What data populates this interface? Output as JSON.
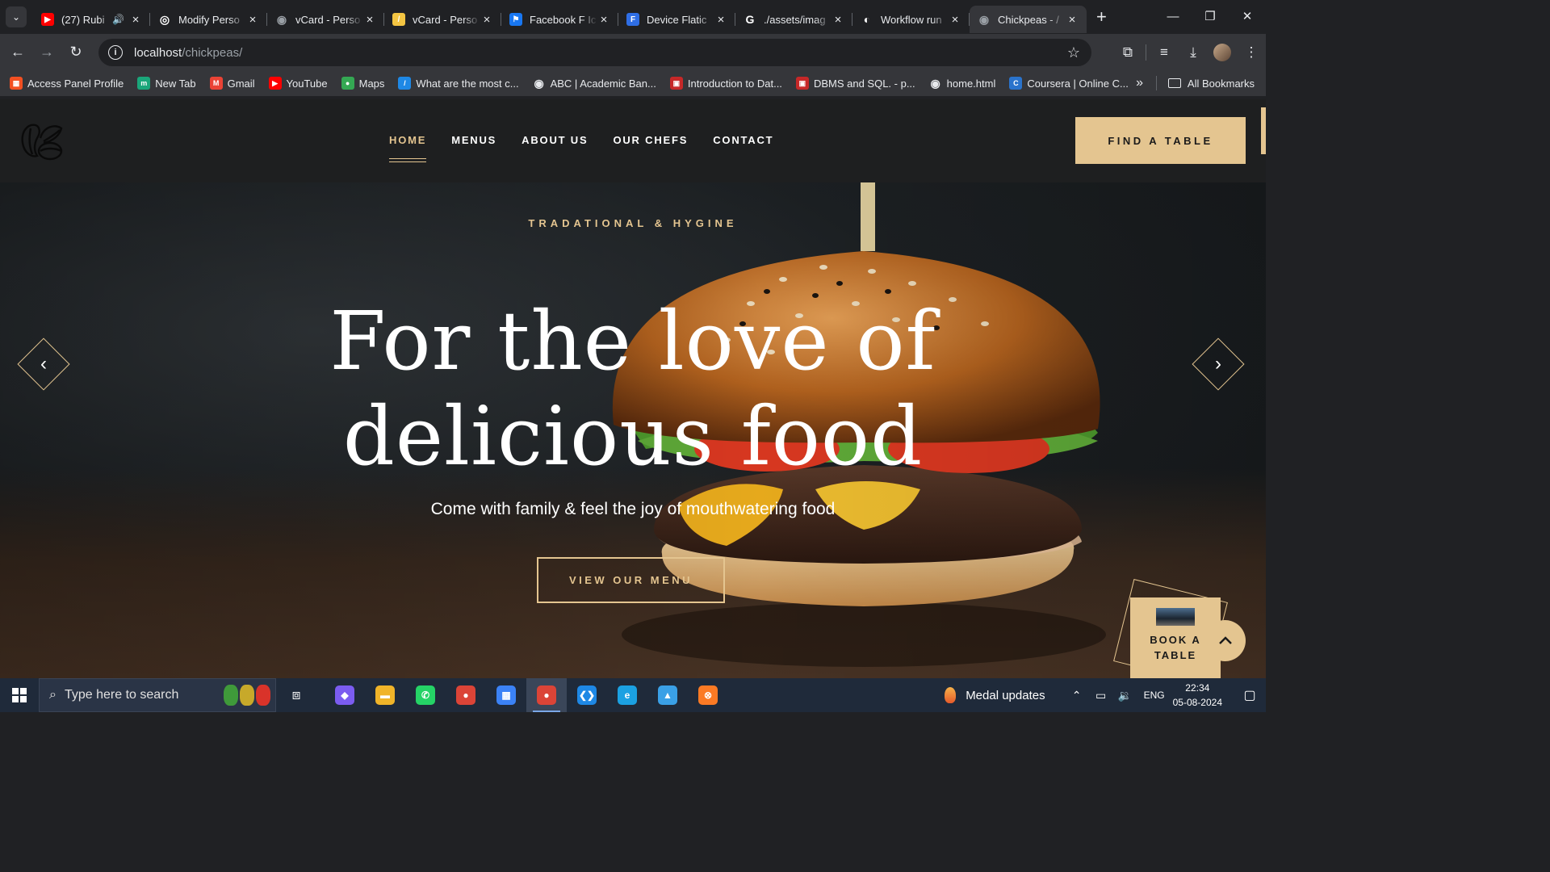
{
  "browser": {
    "tabs": [
      {
        "title": "(27) Rubi",
        "favicon_color": "#ff0000",
        "favicon_glyph": "▶",
        "audio": true,
        "active": false
      },
      {
        "title": "Modify Perso",
        "favicon_color": "#ffffff",
        "favicon_glyph": "◎",
        "audio": false,
        "active": false
      },
      {
        "title": "vCard - Perso",
        "favicon_color": "#9aa0a6",
        "favicon_glyph": "◉",
        "audio": false,
        "active": false
      },
      {
        "title": "vCard - Perso",
        "favicon_color": "#f4c542",
        "favicon_glyph": "/",
        "audio": false,
        "active": false
      },
      {
        "title": "Facebook F Ic",
        "favicon_color": "#1877f2",
        "favicon_glyph": "⚑",
        "audio": false,
        "active": false
      },
      {
        "title": "Device Flatic",
        "favicon_color": "#2f6ee5",
        "favicon_glyph": "F",
        "audio": false,
        "active": false
      },
      {
        "title": "./assets/imag",
        "favicon_color": "#ffffff",
        "favicon_glyph": "G",
        "audio": false,
        "active": false
      },
      {
        "title": "Workflow run",
        "favicon_color": "#ffffff",
        "favicon_glyph": "◐",
        "audio": false,
        "active": false
      },
      {
        "title": "Chickpeas - /",
        "favicon_color": "#9aa0a6",
        "favicon_glyph": "◉",
        "audio": false,
        "active": true
      }
    ],
    "url_host": "localhost",
    "url_path": "/chickpeas/",
    "bookmarks": [
      {
        "label": "Access Panel Profile",
        "color": "#f25022",
        "glyph": "▦"
      },
      {
        "label": "New Tab",
        "color": "#1aa67a",
        "glyph": "m"
      },
      {
        "label": "Gmail",
        "color": "#ea4335",
        "glyph": "M"
      },
      {
        "label": "YouTube",
        "color": "#ff0000",
        "glyph": "▶"
      },
      {
        "label": "Maps",
        "color": "#34a853",
        "glyph": "●"
      },
      {
        "label": "What are the most c...",
        "color": "#1e88e5",
        "glyph": "/"
      },
      {
        "label": "ABC | Academic Ban...",
        "color": "#9aa0a6",
        "glyph": "◉"
      },
      {
        "label": "Introduction to Dat...",
        "color": "#c62828",
        "glyph": "▣"
      },
      {
        "label": "DBMS and SQL. - p...",
        "color": "#c62828",
        "glyph": "▣"
      },
      {
        "label": "home.html",
        "color": "#9aa0a6",
        "glyph": "◉"
      },
      {
        "label": "Coursera | Online C...",
        "color": "#2a73cc",
        "glyph": "C"
      }
    ],
    "all_bookmarks_label": "All Bookmarks"
  },
  "site": {
    "nav": [
      {
        "label": "HOME",
        "active": true
      },
      {
        "label": "MENUS",
        "active": false
      },
      {
        "label": "ABOUT US",
        "active": false
      },
      {
        "label": "OUR CHEFS",
        "active": false
      },
      {
        "label": "CONTACT",
        "active": false
      }
    ],
    "find_table_label": "FIND A TABLE",
    "hero": {
      "subtitle": "TRADATIONAL & HYGINE",
      "headline_line1": "For the love of",
      "headline_line2": "delicious food",
      "tagline": "Come with family & feel the joy of mouthwatering food",
      "cta_label": "VIEW OUR MENU"
    },
    "book_label": "BOOK A TABLE",
    "colors": {
      "accent": "#e4c590",
      "header_bg": "#1e1f20"
    }
  },
  "taskbar": {
    "search_placeholder": "Type here to search",
    "apps": [
      {
        "name": "copilot",
        "color": "#7b5cf0",
        "glyph": "◆"
      },
      {
        "name": "file-explorer",
        "color": "#f0b429",
        "glyph": "▬"
      },
      {
        "name": "whatsapp",
        "color": "#25d366",
        "glyph": "✆"
      },
      {
        "name": "chrome",
        "color": "#db4437",
        "glyph": "●"
      },
      {
        "name": "microsoft-store",
        "color": "#3b82f6",
        "glyph": "▦"
      },
      {
        "name": "chrome-profile",
        "color": "#db4437",
        "glyph": "●",
        "active": true
      },
      {
        "name": "vscode",
        "color": "#1e88e5",
        "glyph": "❮❯"
      },
      {
        "name": "edge",
        "color": "#1ba1e2",
        "glyph": "e"
      },
      {
        "name": "paint",
        "color": "#3aa0e6",
        "glyph": "▲"
      },
      {
        "name": "xampp",
        "color": "#fb7a24",
        "glyph": "⊗"
      }
    ],
    "medal_label": "Medal updates",
    "language": "ENG",
    "time": "22:34",
    "date": "05-08-2024"
  }
}
